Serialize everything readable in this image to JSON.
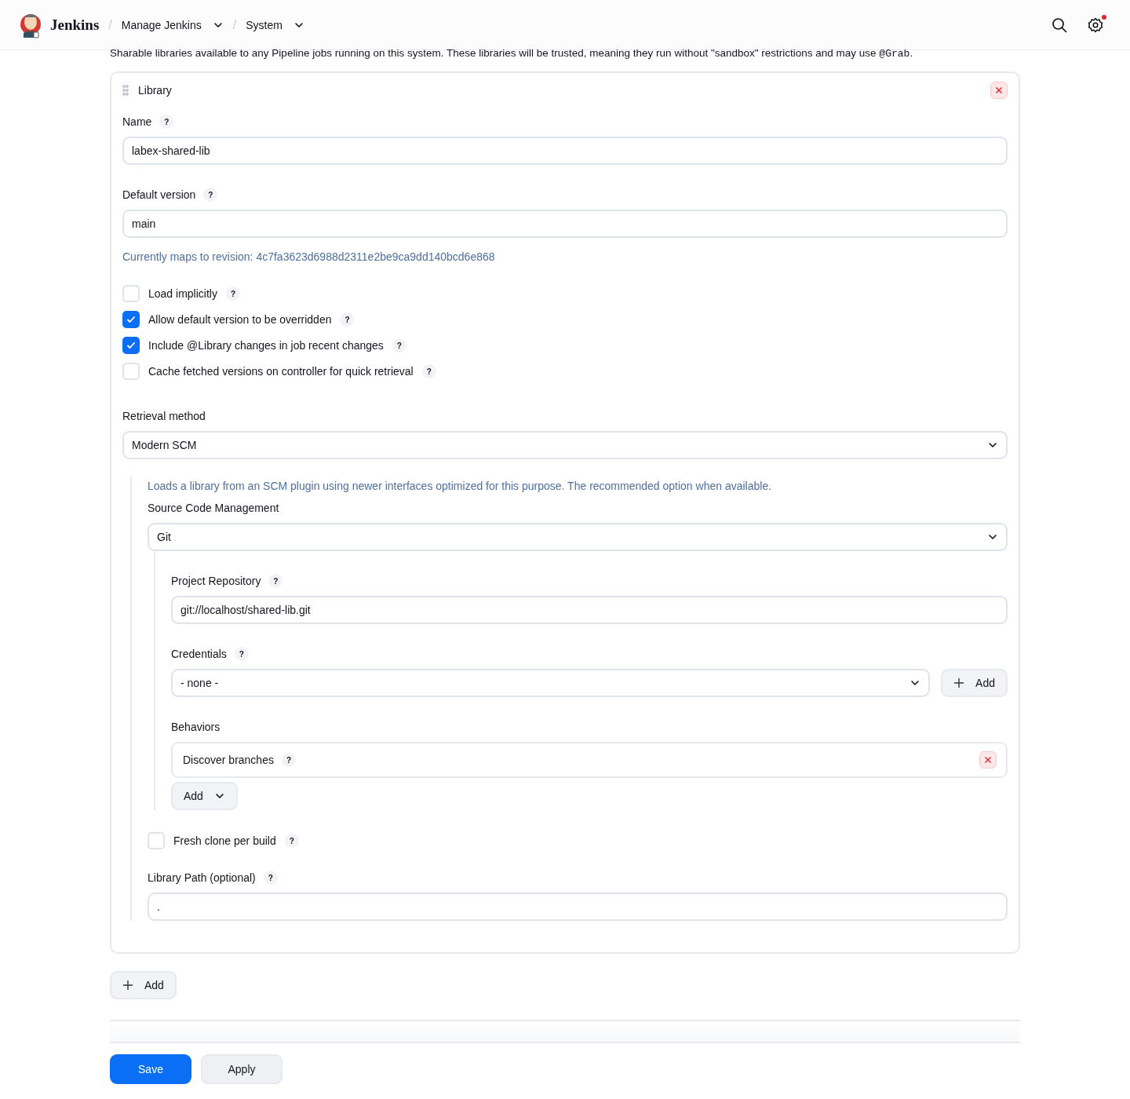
{
  "header": {
    "brand": "Jenkins",
    "breadcrumbs": [
      {
        "separator": "/",
        "label": "Manage Jenkins"
      },
      {
        "separator": "/",
        "label": "System"
      }
    ],
    "settings_notification": true
  },
  "description": {
    "before": "Sharable libraries available to any Pipeline jobs running on this system. These libraries will be trusted, meaning they run without \"sandbox\" restrictions and may use ",
    "code": "@Grab",
    "after": "."
  },
  "library": {
    "title": "Library",
    "name": {
      "label": "Name",
      "help": "?",
      "value": "labex-shared-lib"
    },
    "default_version": {
      "label": "Default version",
      "help": "?",
      "value": "main"
    },
    "revision_note": "Currently maps to revision: 4c7fa3623d6988d2311e2be9ca9dd140bcd6e868",
    "options": [
      {
        "label": "Load implicitly",
        "help": "?",
        "checked": false
      },
      {
        "label": "Allow default version to be overridden",
        "help": "?",
        "checked": true
      },
      {
        "label": "Include @Library changes in job recent changes",
        "help": "?",
        "checked": true
      },
      {
        "label": "Cache fetched versions on controller for quick retrieval",
        "help": "?",
        "checked": false
      }
    ],
    "retrieval_method": {
      "label": "Retrieval method",
      "value": "Modern SCM"
    },
    "retrieval_description": "Loads a library from an SCM plugin using newer interfaces optimized for this purpose. The recommended option when available.",
    "scm": {
      "label": "Source Code Management",
      "value": "Git"
    },
    "project_repository": {
      "label": "Project Repository",
      "help": "?",
      "value": "git://localhost/shared-lib.git"
    },
    "credentials": {
      "label": "Credentials",
      "help": "?",
      "value": "- none -",
      "add_button": "Add"
    },
    "behaviors": {
      "label": "Behaviors",
      "items": [
        {
          "label": "Discover branches",
          "help": "?"
        }
      ],
      "add_button": "Add"
    },
    "fresh_clone": {
      "label": "Fresh clone per build",
      "help": "?",
      "checked": false
    },
    "library_path": {
      "label": "Library Path (optional)",
      "help": "?",
      "value": "."
    }
  },
  "add_button": "Add",
  "footer": {
    "save": "Save",
    "apply": "Apply"
  }
}
